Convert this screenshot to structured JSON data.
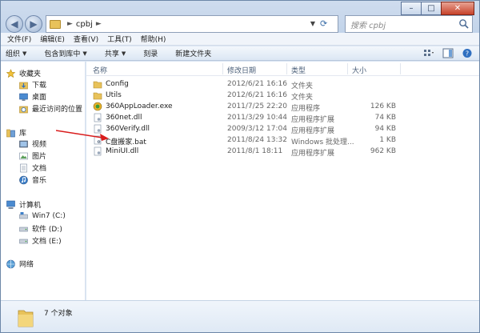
{
  "address": {
    "path": "cpbj"
  },
  "search": {
    "placeholder": "搜索 cpbj"
  },
  "menu": [
    "文件(F)",
    "编辑(E)",
    "查看(V)",
    "工具(T)",
    "帮助(H)"
  ],
  "commands": {
    "organize": "组织",
    "include": "包含到库中",
    "share": "共享",
    "burn": "刻录",
    "new_folder": "新建文件夹"
  },
  "nav": {
    "favorites": "收藏夹",
    "fav_items": [
      "下载",
      "桌面",
      "最近访问的位置"
    ],
    "library": "库",
    "lib_items": [
      "视频",
      "图片",
      "文档",
      "音乐"
    ],
    "computer": "计算机",
    "drives": [
      "Win7 (C:)",
      "软件 (D:)",
      "文档 (E:)"
    ],
    "network": "网络"
  },
  "columns": {
    "name": "名称",
    "date": "修改日期",
    "type": "类型",
    "size": "大小"
  },
  "files": [
    {
      "name": "Config",
      "date": "2012/6/21 16:16",
      "type": "文件夹",
      "size": "",
      "icon": "folder-icon"
    },
    {
      "name": "Utils",
      "date": "2012/6/21 16:16",
      "type": "文件夹",
      "size": "",
      "icon": "folder-icon"
    },
    {
      "name": "360AppLoader.exe",
      "date": "2011/7/25 22:20",
      "type": "应用程序",
      "size": "126 KB",
      "icon": "exe-icon"
    },
    {
      "name": "360net.dll",
      "date": "2011/3/29 10:44",
      "type": "应用程序扩展",
      "size": "74 KB",
      "icon": "dll-icon"
    },
    {
      "name": "360Verify.dll",
      "date": "2009/3/12 17:04",
      "type": "应用程序扩展",
      "size": "94 KB",
      "icon": "dll-icon"
    },
    {
      "name": "C盘搬家.bat",
      "date": "2011/8/24 13:32",
      "type": "Windows 批处理...",
      "size": "1 KB",
      "icon": "bat-icon"
    },
    {
      "name": "MiniUI.dll",
      "date": "2011/8/1 18:11",
      "type": "应用程序扩展",
      "size": "962 KB",
      "icon": "dll-icon"
    }
  ],
  "status": {
    "count": "7 个对象"
  }
}
